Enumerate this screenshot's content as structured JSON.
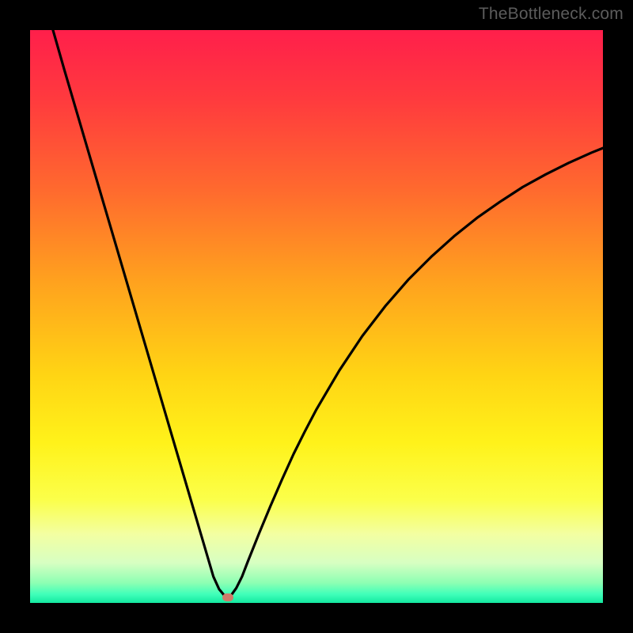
{
  "watermark": "TheBottleneck.com",
  "chart_data": {
    "type": "line",
    "title": "",
    "xlabel": "",
    "ylabel": "",
    "xlim": [
      0,
      100
    ],
    "ylim": [
      0,
      100
    ],
    "grid": false,
    "legend": false,
    "background": {
      "type": "vertical-gradient",
      "stops": [
        {
          "offset": 0.0,
          "color": "#ff1f4b"
        },
        {
          "offset": 0.12,
          "color": "#ff3a3e"
        },
        {
          "offset": 0.28,
          "color": "#ff6a2e"
        },
        {
          "offset": 0.44,
          "color": "#ffa21e"
        },
        {
          "offset": 0.6,
          "color": "#ffd414"
        },
        {
          "offset": 0.72,
          "color": "#fff21a"
        },
        {
          "offset": 0.82,
          "color": "#fbff4a"
        },
        {
          "offset": 0.88,
          "color": "#f3ffa2"
        },
        {
          "offset": 0.93,
          "color": "#d7ffc2"
        },
        {
          "offset": 0.965,
          "color": "#8dffb3"
        },
        {
          "offset": 0.985,
          "color": "#3fffb9"
        },
        {
          "offset": 1.0,
          "color": "#14e8a0"
        }
      ]
    },
    "series": [
      {
        "name": "bottleneck-curve",
        "color": "#000000",
        "x": [
          4,
          6,
          8,
          10,
          12,
          14,
          16,
          18,
          20,
          22,
          24,
          26,
          28,
          30,
          31,
          32,
          33,
          34,
          34.5,
          35,
          36,
          37,
          38,
          40,
          42,
          44,
          46,
          48,
          50,
          54,
          58,
          62,
          66,
          70,
          74,
          78,
          82,
          86,
          90,
          94,
          98,
          100
        ],
        "y": [
          100,
          93,
          86.2,
          79.4,
          72.6,
          65.8,
          59,
          52.2,
          45.4,
          38.6,
          31.8,
          25,
          18.2,
          11.4,
          8,
          4.6,
          2.4,
          1.2,
          1.0,
          1.2,
          2.6,
          4.6,
          7.2,
          12.2,
          17,
          21.6,
          26,
          30,
          33.8,
          40.6,
          46.6,
          51.8,
          56.4,
          60.4,
          64,
          67.2,
          70,
          72.6,
          74.8,
          76.8,
          78.6,
          79.4
        ]
      }
    ],
    "marker": {
      "x": 34.5,
      "y": 1.0,
      "color": "#cf7a6a"
    }
  }
}
